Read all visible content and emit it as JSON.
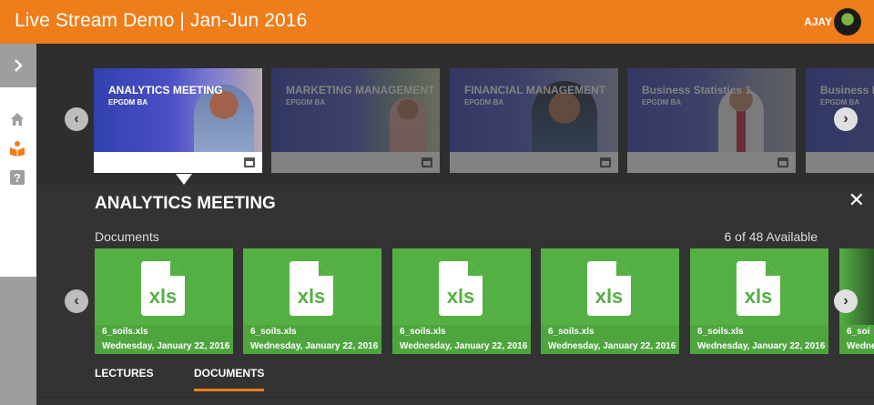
{
  "header": {
    "title": "Live Stream Demo | Jan-Jun 2016",
    "user": "AJAY",
    "accent": "#ef7d1a"
  },
  "sidebar": {
    "toggle_icon": "chevron-right-icon",
    "items": [
      {
        "icon": "home-icon"
      },
      {
        "icon": "book-reader-icon"
      },
      {
        "icon": "help-icon"
      }
    ]
  },
  "courses": [
    {
      "title": "ANALYTICS MEETING",
      "sub": "EPGDM BA",
      "selected": true
    },
    {
      "title": "MARKETING MANAGEMENT",
      "sub": "EPGDM BA",
      "selected": false
    },
    {
      "title": "FINANCIAL MANAGEMENT",
      "sub": "EPGDM BA",
      "selected": false
    },
    {
      "title": "Business Statistics 1",
      "sub": "EPGDM BA",
      "selected": false
    },
    {
      "title": "Business Ec",
      "sub": "EPGDM BA",
      "selected": false
    }
  ],
  "details": {
    "title": "ANALYTICS MEETING",
    "section_label": "Documents",
    "count": "6 of 48 Available",
    "documents": [
      {
        "type": "xls",
        "name": "6_soils.xls",
        "date": "Wednesday, January 22, 2016"
      },
      {
        "type": "xls",
        "name": "6_soils.xls",
        "date": "Wednesday, January 22, 2016"
      },
      {
        "type": "xls",
        "name": "6_soils.xls",
        "date": "Wednesday, January 22, 2016"
      },
      {
        "type": "xls",
        "name": "6_soils.xls",
        "date": "Wednesday, January 22, 2016"
      },
      {
        "type": "xls",
        "name": "6_soils.xls",
        "date": "Wednesday, January 22, 2016"
      },
      {
        "type": "",
        "name": "6_soi",
        "date": "Wedne"
      }
    ],
    "tabs": [
      {
        "label": "LECTURES",
        "active": false
      },
      {
        "label": "DOCUMENTS",
        "active": true
      }
    ]
  }
}
